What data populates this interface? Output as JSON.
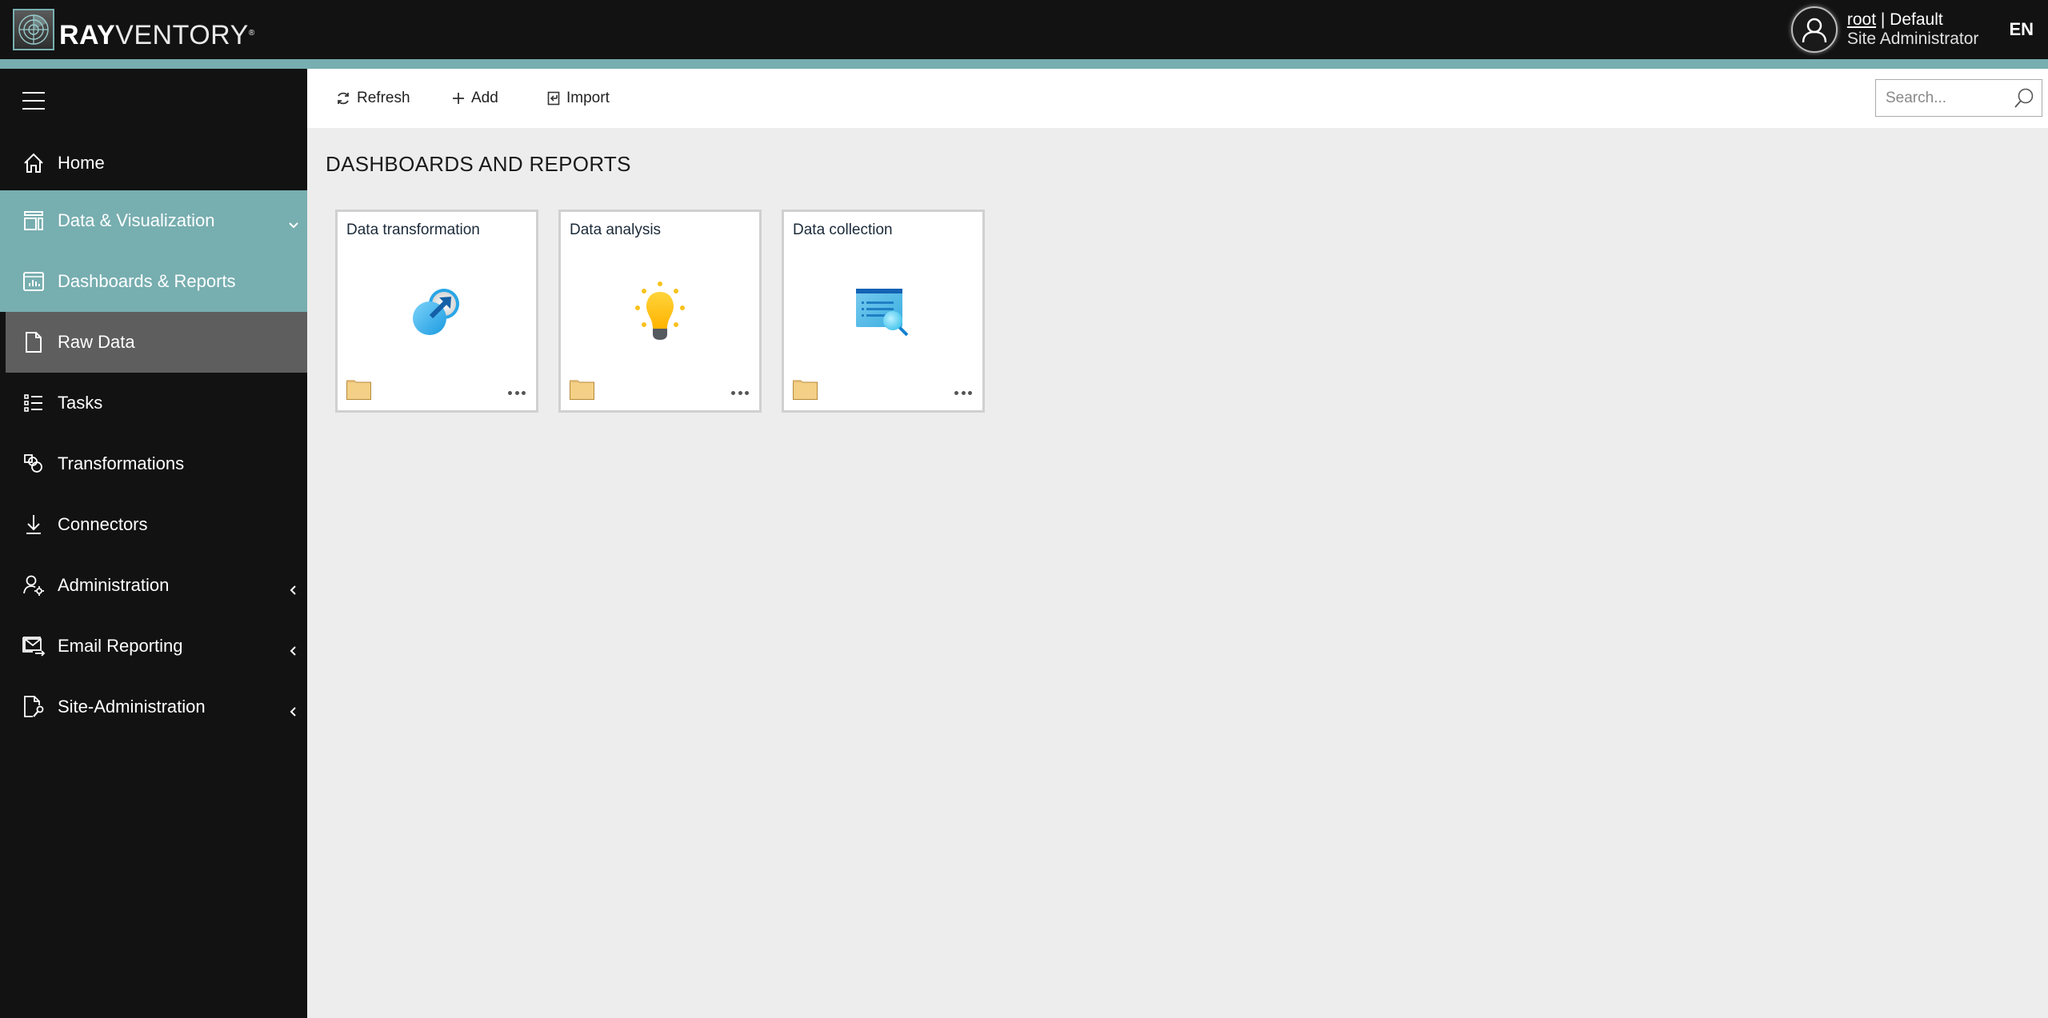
{
  "header": {
    "logo_bold": "RAY",
    "logo_light": "VENTORY",
    "logo_mark": "®",
    "user_name": "root",
    "separator": " | ",
    "tenant": "Default",
    "role": "Site Administrator",
    "language": "EN"
  },
  "colors": {
    "accent_teal": "#77aeb0",
    "sidebar_bg": "#121212",
    "hover_grey": "#5e5e5e",
    "content_bg": "#ededed"
  },
  "sidebar": {
    "menu_icon": "hamburger-icon",
    "items": [
      {
        "label": "Home",
        "icon": "home-icon",
        "state": "default"
      },
      {
        "label": "Data & Visualization",
        "icon": "layout-icon",
        "state": "expanded",
        "chevron": "down"
      },
      {
        "label": "Dashboards & Reports",
        "icon": "dashboard-chart-icon",
        "state": "active"
      },
      {
        "label": "Raw Data",
        "icon": "document-icon",
        "state": "hover"
      },
      {
        "label": "Tasks",
        "icon": "task-list-icon",
        "state": "default"
      },
      {
        "label": "Transformations",
        "icon": "shapes-icon",
        "state": "default"
      },
      {
        "label": "Connectors",
        "icon": "download-icon",
        "state": "default"
      },
      {
        "label": "Administration",
        "icon": "user-gear-icon",
        "state": "collapsed",
        "chevron": "left"
      },
      {
        "label": "Email Reporting",
        "icon": "mail-send-icon",
        "state": "collapsed",
        "chevron": "left"
      },
      {
        "label": "Site-Administration",
        "icon": "document-wrench-icon",
        "state": "collapsed",
        "chevron": "left"
      }
    ]
  },
  "toolbar": {
    "refresh_label": "Refresh",
    "add_label": "Add",
    "import_label": "Import",
    "search_placeholder": "Search...",
    "search_value": ""
  },
  "main": {
    "title": "DASHBOARDS AND REPORTS",
    "cards": [
      {
        "title": "Data transformation",
        "icon": "data-transformation-icon"
      },
      {
        "title": "Data analysis",
        "icon": "lightbulb-icon"
      },
      {
        "title": "Data collection",
        "icon": "data-collection-icon"
      }
    ]
  }
}
